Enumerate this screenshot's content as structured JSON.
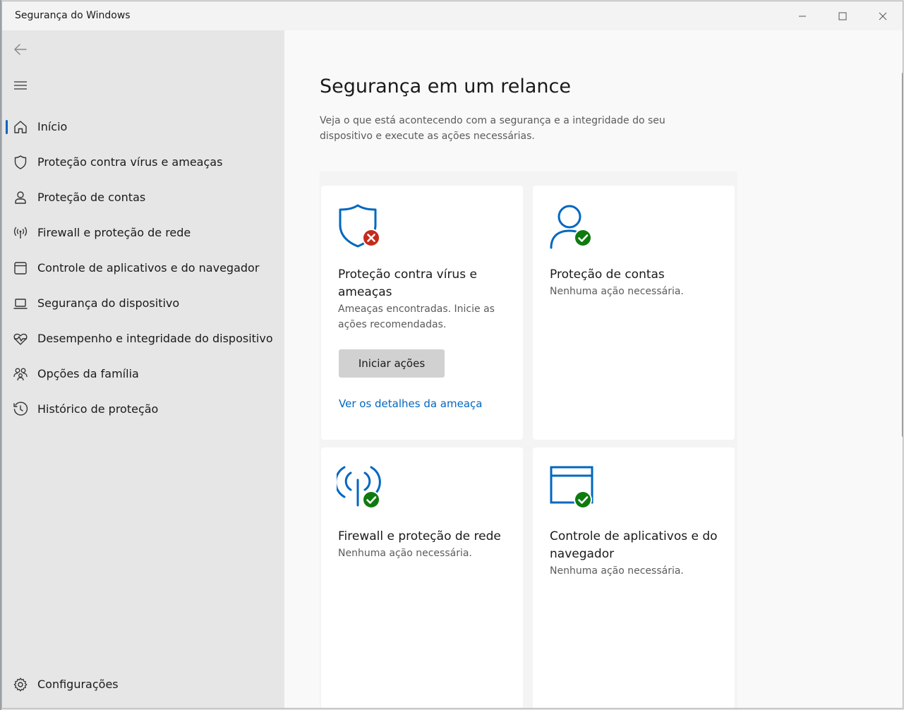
{
  "window": {
    "title": "Segurança do Windows"
  },
  "nav": {
    "items": [
      {
        "label": "Início",
        "icon": "home-icon",
        "selected": true
      },
      {
        "label": "Proteção contra vírus e ameaças",
        "icon": "shield-icon"
      },
      {
        "label": "Proteção de contas",
        "icon": "person-icon"
      },
      {
        "label": "Firewall e proteção de rede",
        "icon": "antenna-icon"
      },
      {
        "label": "Controle de aplicativos e do navegador",
        "icon": "browser-window-icon"
      },
      {
        "label": "Segurança do dispositivo",
        "icon": "laptop-icon"
      },
      {
        "label": "Desempenho e integridade do dispositivo",
        "icon": "heart-pulse-icon"
      },
      {
        "label": "Opções da família",
        "icon": "family-icon"
      },
      {
        "label": "Histórico de proteção",
        "icon": "history-icon"
      }
    ],
    "settings_label": "Configurações"
  },
  "main": {
    "title": "Segurança em um relance",
    "description": "Veja o que está acontecendo com a segurança e a integridade do seu dispositivo e execute as ações necessárias.",
    "cards": [
      {
        "title": "Proteção contra vírus e ameaças",
        "status": "Ameaças encontradas. Inicie as ações recomendadas.",
        "button": "Iniciar ações",
        "link": "Ver os detalhes da ameaça",
        "icon": "shield-error-icon"
      },
      {
        "title": "Proteção de contas",
        "status": "Nenhuma ação necessária.",
        "icon": "person-ok-icon"
      },
      {
        "title": "Firewall e proteção de rede",
        "status": "Nenhuma ação necessária.",
        "icon": "antenna-ok-icon"
      },
      {
        "title": "Controle de aplicativos e do navegador",
        "status": "Nenhuma ação necessária.",
        "icon": "browser-window-ok-icon"
      }
    ]
  },
  "colors": {
    "accent": "#0067c0",
    "ok": "#0f7b0f",
    "error": "#c42b1c"
  }
}
